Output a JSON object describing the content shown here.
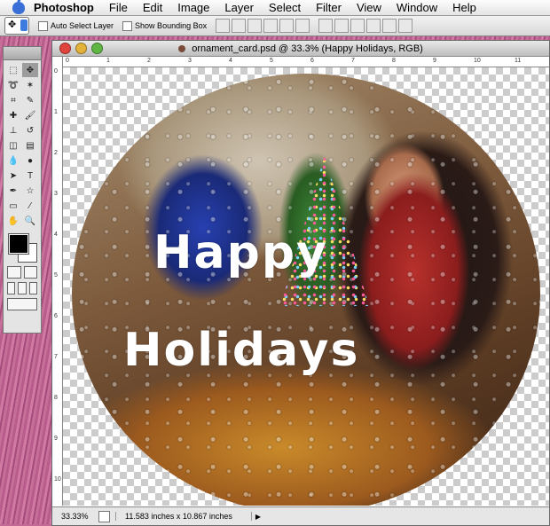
{
  "menubar": {
    "app": "Photoshop",
    "items": [
      "File",
      "Edit",
      "Image",
      "Layer",
      "Select",
      "Filter",
      "View",
      "Window",
      "Help"
    ]
  },
  "options": {
    "auto_select": "Auto Select Layer",
    "bounding_box": "Show Bounding Box"
  },
  "document": {
    "title": "ornament_card.psd @ 33.3% (Happy Holidays, RGB)",
    "ruler_top": [
      "0",
      "1",
      "2",
      "3",
      "4",
      "5",
      "6",
      "7",
      "8",
      "9",
      "10",
      "11"
    ],
    "ruler_left": [
      "0",
      "1",
      "2",
      "3",
      "4",
      "5",
      "6",
      "7",
      "8",
      "9",
      "10"
    ],
    "greeting_line1": "Happy",
    "greeting_line2": "Holidays"
  },
  "status": {
    "zoom": "33.33%",
    "doc_size": "11.583 inches x 10.867 inches"
  },
  "colors": {
    "foreground": "#000000",
    "background": "#ffffff"
  }
}
